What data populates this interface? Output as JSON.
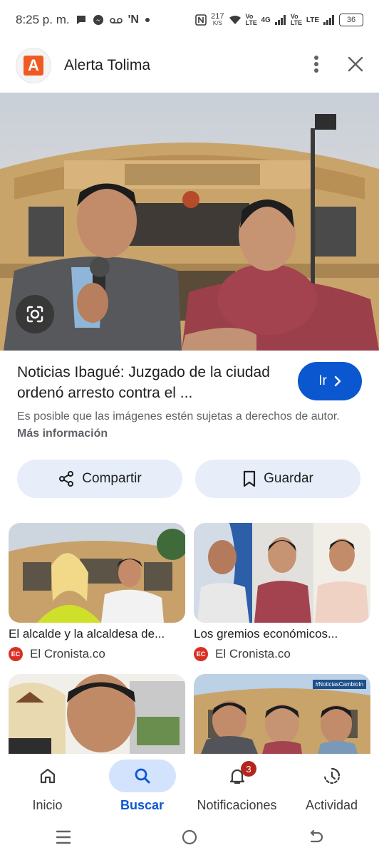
{
  "status_bar": {
    "time": "8:25 p. m.",
    "speed": "217",
    "speed_unit": "K/S",
    "volte1": "Vo LTE",
    "net": "4G",
    "volte2": "Vo LTE",
    "lte": "LTE",
    "battery": "36"
  },
  "header": {
    "logo_letter": "A",
    "site_name": "Alerta Tolima"
  },
  "article": {
    "title": "Noticias Ibagué: Juzgado de la ciudad ordenó arresto contra el ...",
    "go_label": "Ir",
    "copyright_text": "Es posible que las imágenes estén sujetas a derechos de autor.",
    "more_info": "Más información"
  },
  "actions": {
    "share_label": "Compartir",
    "save_label": "Guardar"
  },
  "related": [
    {
      "caption": "El alcalde y la alcaldesa de...",
      "source": "El Cronista.co",
      "source_badge": "EC"
    },
    {
      "caption": "Los gremios económicos...",
      "source": "El Cronista.co",
      "source_badge": "EC"
    },
    {
      "overlay_tag": "#NoticiasCambioIn"
    }
  ],
  "bottom_nav": {
    "items": [
      {
        "label": "Inicio",
        "icon": "home-icon"
      },
      {
        "label": "Buscar",
        "icon": "search-icon",
        "active": true
      },
      {
        "label": "Notificaciones",
        "icon": "bell-icon",
        "badge": "3"
      },
      {
        "label": "Actividad",
        "icon": "activity-icon"
      }
    ]
  },
  "colors": {
    "accent": "#0b57d0",
    "button_bg": "#e7eef9",
    "badge": "#b3261e",
    "logo": "#f05a22"
  }
}
